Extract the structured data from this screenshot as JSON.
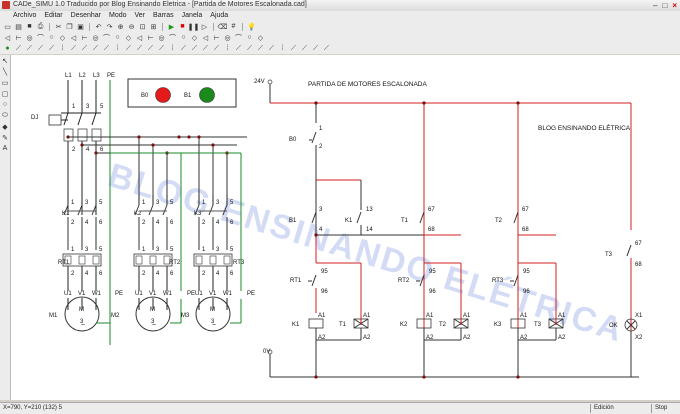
{
  "window": {
    "title": "CADe_SIMU 1.0 Traducido por Blog Ensinando Eletrica - [Partida de Motores Escalonada.cad]"
  },
  "menu": [
    "Archivo",
    "Editar",
    "Desenhar",
    "Modo",
    "Ver",
    "Barras",
    "Janela",
    "Ajuda"
  ],
  "toolbar1": [
    "new",
    "open",
    "save",
    "print",
    "sep",
    "cut",
    "copy",
    "paste",
    "sep",
    "undo",
    "redo",
    "zoom-in",
    "zoom-out",
    "zoom-fit",
    "zoom-window",
    "sep",
    "play",
    "stop",
    "pause",
    "step",
    "sep",
    "clear",
    "grid",
    "sep",
    "idea"
  ],
  "toolbar2_count": 24,
  "toolbar3_count": 30,
  "left_tools": [
    "pointer-icon",
    "line-icon",
    "rectangle-icon",
    "rounded-rect-icon",
    "circle-icon",
    "ellipse-icon",
    "fill-icon",
    "pen-icon",
    "text-icon"
  ],
  "diagram": {
    "title": "PARTIDA DE MOTORES ESCALONADA",
    "blog": "BLOG ENSINANDO ELÉTRICA",
    "watermark": "BLOG ENSINANDO ELÉTRICA",
    "supply_top": "24V",
    "supply_bottom": "0V",
    "b0": "B0",
    "b1": "B1",
    "phases": [
      "L1",
      "L2",
      "L3",
      "PE"
    ],
    "dj": "DJ",
    "nums_top": [
      "1",
      "3",
      "5"
    ],
    "nums_bot": [
      "2",
      "4",
      "6"
    ],
    "contactors": [
      "K1",
      "K2",
      "K3"
    ],
    "relays": [
      "RT1",
      "RT2",
      "RT3"
    ],
    "motor_terms": [
      "U1",
      "V1",
      "W1",
      "PE"
    ],
    "motors": [
      "M1",
      "M2",
      "M3"
    ],
    "motor_symbol": "M",
    "motor_phase": "3",
    "timers": [
      "T1",
      "T2",
      "T3"
    ],
    "t_nums": [
      "67",
      "68"
    ],
    "k_nums": [
      "13",
      "14"
    ],
    "b_nums": [
      "1",
      "2",
      "3",
      "4"
    ],
    "rt_nums": [
      "95",
      "96"
    ],
    "coil_nums": [
      "A1",
      "A2"
    ],
    "lamp_label": "OK",
    "lamp_nums": [
      "X1",
      "X2"
    ]
  },
  "status": {
    "coords": "X=790, Y=210 (132) 5",
    "mode": "Edición",
    "state": "Stop"
  },
  "colors": {
    "red_wire": "#d22020",
    "green_wire": "#1a8a2a",
    "black_wire": "#222222",
    "lamp_red": "#e31b1b",
    "lamp_green": "#1a8a1a"
  }
}
